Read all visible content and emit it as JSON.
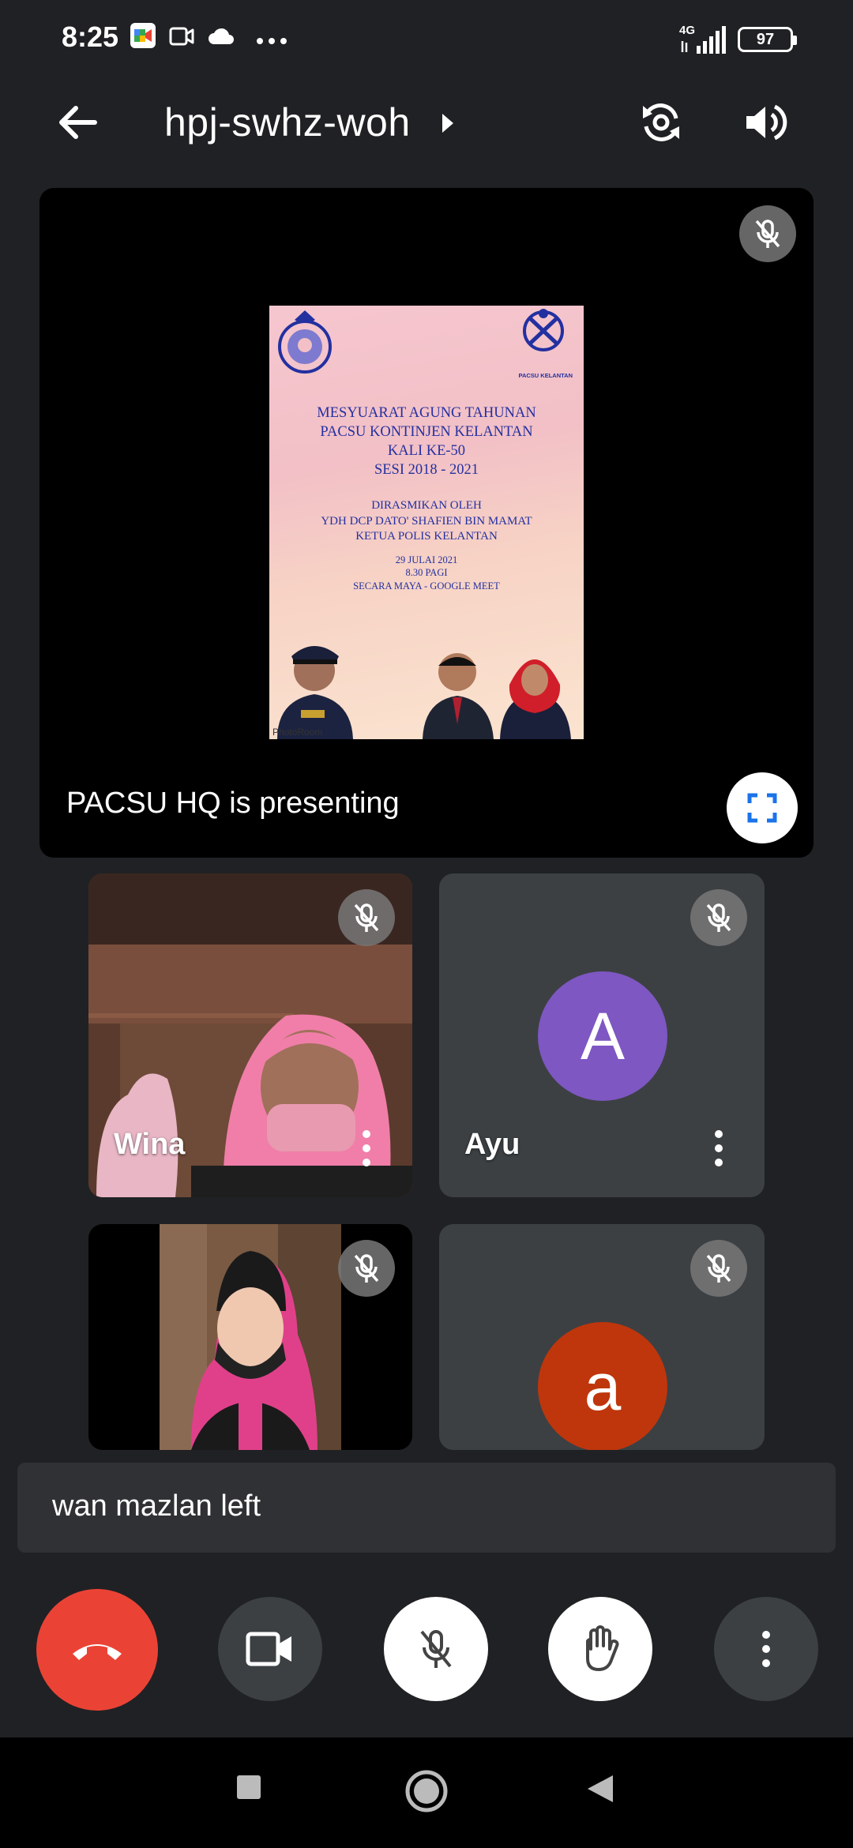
{
  "status_bar": {
    "time": "8:25",
    "network": "4G",
    "battery": "97"
  },
  "header": {
    "meeting_code": "hpj-swhz-woh"
  },
  "presentation": {
    "slide": {
      "title_lines": [
        "MESYUARAT AGUNG TAHUNAN",
        "PACSU KONTINJEN KELANTAN",
        "KALI KE-50",
        "SESI 2018 - 2021"
      ],
      "officiated_lines": [
        "DIRASMIKAN OLEH",
        "YDH DCP DATO' SHAFIEN BIN MAMAT",
        "KETUA POLIS KELANTAN"
      ],
      "time_lines": [
        "29 JULAI 2021",
        "8.30 PAGI",
        "SECARA MAYA - GOOGLE MEET"
      ],
      "logo_right_caption": "PACSU KELANTAN",
      "watermark": "PhotoRoom"
    },
    "presenter_label": "PACSU HQ is presenting"
  },
  "participants": [
    {
      "name": "Wina",
      "muted": true
    },
    {
      "name": "Ayu",
      "initial": "A",
      "avatar_color": "#7e57c2",
      "muted": true
    },
    {
      "name": "",
      "muted": true
    },
    {
      "name": "",
      "initial": "a",
      "avatar_color": "#bf360c",
      "muted": true
    }
  ],
  "toast": {
    "message": "wan mazlan left"
  },
  "controls": {
    "end_call_color": "#ea4335"
  },
  "icons": [
    "back-arrow-icon",
    "play-arrow-icon",
    "camera-switch-icon",
    "volume-icon",
    "mic-off-icon",
    "fullscreen-icon",
    "more-vert-icon",
    "call-end-icon",
    "videocam-icon",
    "hand-icon",
    "nav-square-icon",
    "nav-circle-icon",
    "nav-triangle-icon"
  ]
}
